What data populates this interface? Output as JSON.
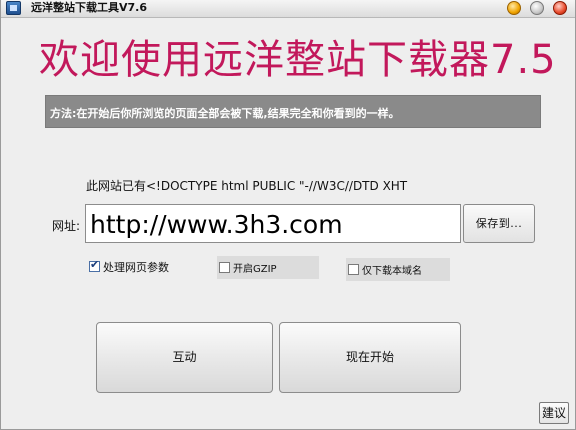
{
  "window": {
    "title": "远洋整站下载工具V7.6"
  },
  "headline": "欢迎使用远洋整站下载器7.5",
  "method_text": "方法:在开始后你所浏览的页面全部会被下载,结果完全和你看到的一样。",
  "site_info": "此网站已有<!DOCTYPE html PUBLIC \"-//W3C//DTD XHT",
  "url_form": {
    "label": "网址:",
    "value": "http://www.3h3.com",
    "save_label": "保存到..."
  },
  "options": [
    {
      "label": "处理网页参数",
      "checked": true
    },
    {
      "label": "开启GZIP",
      "checked": false
    },
    {
      "label": "仅下载本域名",
      "checked": false
    }
  ],
  "buttons": {
    "interact": "互动",
    "start": "现在开始",
    "suggest": "建议"
  },
  "icons": {
    "checkmark": "✔",
    "app": "app-icon"
  },
  "colors": {
    "headline": "#c2185b",
    "method_bar": "#8a8a8a"
  }
}
